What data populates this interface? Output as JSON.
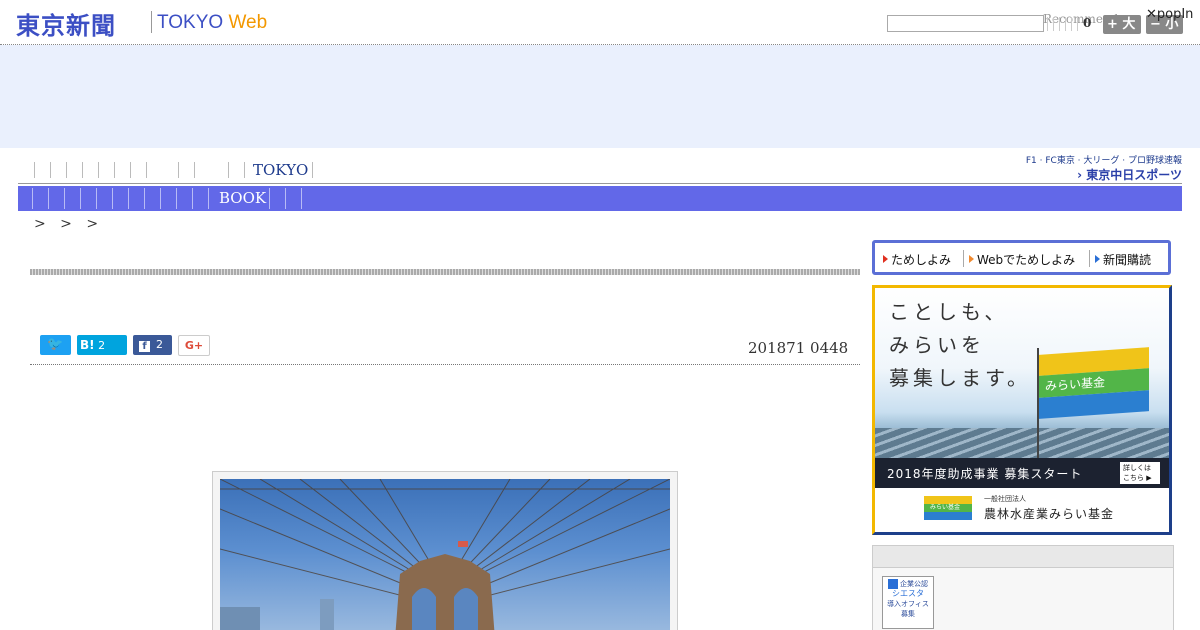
{
  "header": {
    "logo_jp": "東京新聞",
    "logo_en_main": "TOKYO ",
    "logo_en_web": "Web",
    "search_placeholder": "",
    "recommend": "Recommend",
    "count": "0",
    "btn_large": "+ 大",
    "btn_small": "− 小",
    "popin": "✕popIn"
  },
  "nav": {
    "tokyo_label": "TOKYO",
    "book_label": "BOOK",
    "sports_line1": "F1 · FC東京 · 大リーグ · プロ野球速報",
    "sports_line2": "› 東京中日スポーツ"
  },
  "breadcrumb": "> > >",
  "article": {
    "share_twitter": "🐦",
    "share_hatena_mark": "B!",
    "share_hatena_count": "2",
    "share_fb_mark": "f",
    "share_fb_count": "2",
    "share_gplus": "G+",
    "date": "201871 0448"
  },
  "sidebar": {
    "tameshi_items": [
      "ためしよみ",
      "Webでためしよみ",
      "新聞購読"
    ],
    "mirai_lines": [
      "ことしも、",
      "みらいを",
      "募集します。"
    ],
    "mirai_flag_label": "みらい基金",
    "mirai_strip": "2018年度助成事業 募集スタート",
    "mirai_detail": "詳しくは こちら ▶",
    "mirai_foot_small": "一般社団法人",
    "mirai_foot_name": "農林水産業みらい基金",
    "mirai_foot_logo": "みらい基金",
    "badge_lines": [
      "企業公認",
      "シエスタ",
      "導入オフィス",
      "募集"
    ]
  }
}
